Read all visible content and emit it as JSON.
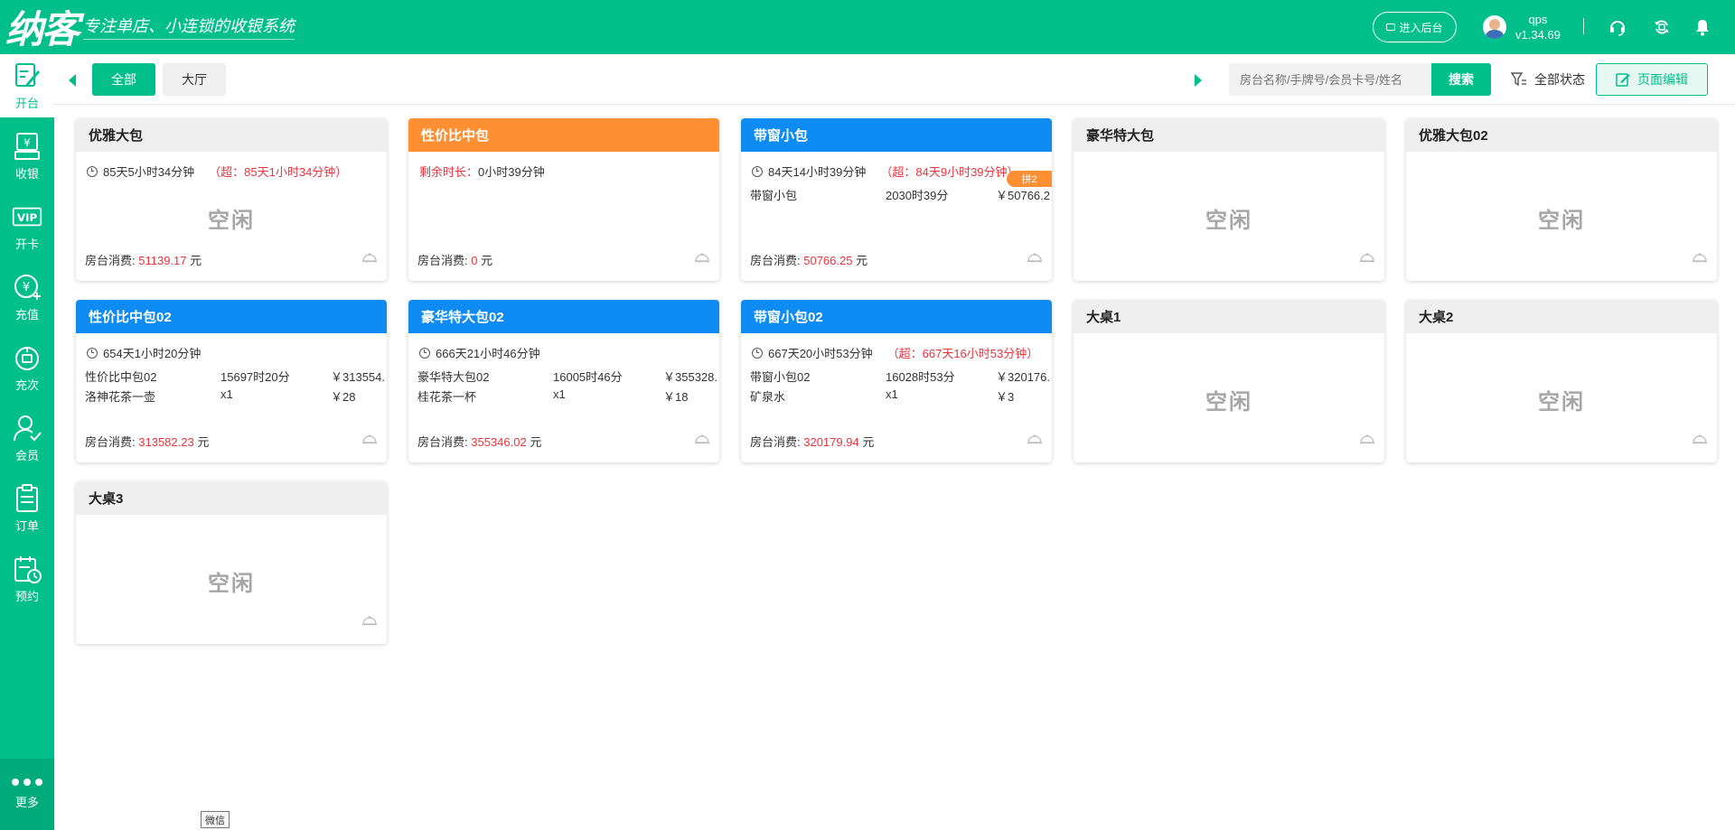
{
  "brand": {
    "name": "纳客",
    "slogan": "专注单店、小连锁的收银系统"
  },
  "header": {
    "backend_label": "进入后台",
    "user_name": "qps",
    "version": "v1.34.69"
  },
  "sidebar": {
    "items": [
      {
        "label": "开台"
      },
      {
        "label": "收银"
      },
      {
        "label": "开卡",
        "icon_text": "VIP"
      },
      {
        "label": "充值"
      },
      {
        "label": "充次"
      },
      {
        "label": "会员"
      },
      {
        "label": "订单"
      },
      {
        "label": "预约"
      }
    ],
    "more_label": "更多"
  },
  "toolbar": {
    "areas": [
      "全部",
      "大厅"
    ],
    "search_placeholder": "房台名称/手牌号/会员卡号/姓名",
    "search_label": "搜索",
    "filter_label": "全部状态",
    "edit_label": "页面编辑"
  },
  "common": {
    "idle": "空闲",
    "consume_label": "房台消费: ",
    "currency_unit": "元"
  },
  "cards": [
    {
      "name": "优雅大包",
      "timer": "85天5小时34分钟",
      "overtime": "（超：85天1小时34分钟）",
      "consume": "51139.17"
    },
    {
      "name": "性价比中包",
      "remaining_label": "剩余时长：",
      "remaining": "0小时39分钟",
      "consume": "0"
    },
    {
      "name": "带窗小包",
      "timer": "84天14小时39分钟",
      "overtime": "（超：84天9小时39分钟）",
      "badge": "拼2",
      "items": [
        {
          "name": "带窗小包",
          "qty": "2030时39分",
          "price": "￥50766.2"
        }
      ],
      "consume": "50766.25"
    },
    {
      "name": "豪华特大包"
    },
    {
      "name": "优雅大包02"
    },
    {
      "name": "性价比中包02",
      "timer": "654天1小时20分钟",
      "items": [
        {
          "name": "性价比中包02",
          "qty": "15697时20分",
          "price": "￥313554."
        },
        {
          "name": "洛神花茶一壶",
          "qty": "x1",
          "price": "￥28"
        }
      ],
      "consume": "313582.23"
    },
    {
      "name": "豪华特大包02",
      "timer": "666天21小时46分钟",
      "items": [
        {
          "name": "豪华特大包02",
          "qty": "16005时46分",
          "price": "￥355328."
        },
        {
          "name": "桂花茶一杯",
          "qty": "x1",
          "price": "￥18"
        }
      ],
      "consume": "355346.02"
    },
    {
      "name": "带窗小包02",
      "timer": "667天20小时53分钟",
      "overtime": "（超：667天16小时53分钟）",
      "items": [
        {
          "name": "带窗小包02",
          "qty": "16028时53分",
          "price": "￥320176."
        },
        {
          "name": "矿泉水",
          "qty": "x1",
          "price": "￥3"
        }
      ],
      "consume": "320179.94"
    },
    {
      "name": "大桌1"
    },
    {
      "name": "大桌2"
    },
    {
      "name": "大桌3"
    }
  ],
  "tooltip": "微信",
  "colors": {
    "brand": "#00bf8a",
    "blue": "#0f8cf3",
    "orange": "#ff8f33",
    "red": "#f0323c",
    "idle_head": "#efefef"
  }
}
